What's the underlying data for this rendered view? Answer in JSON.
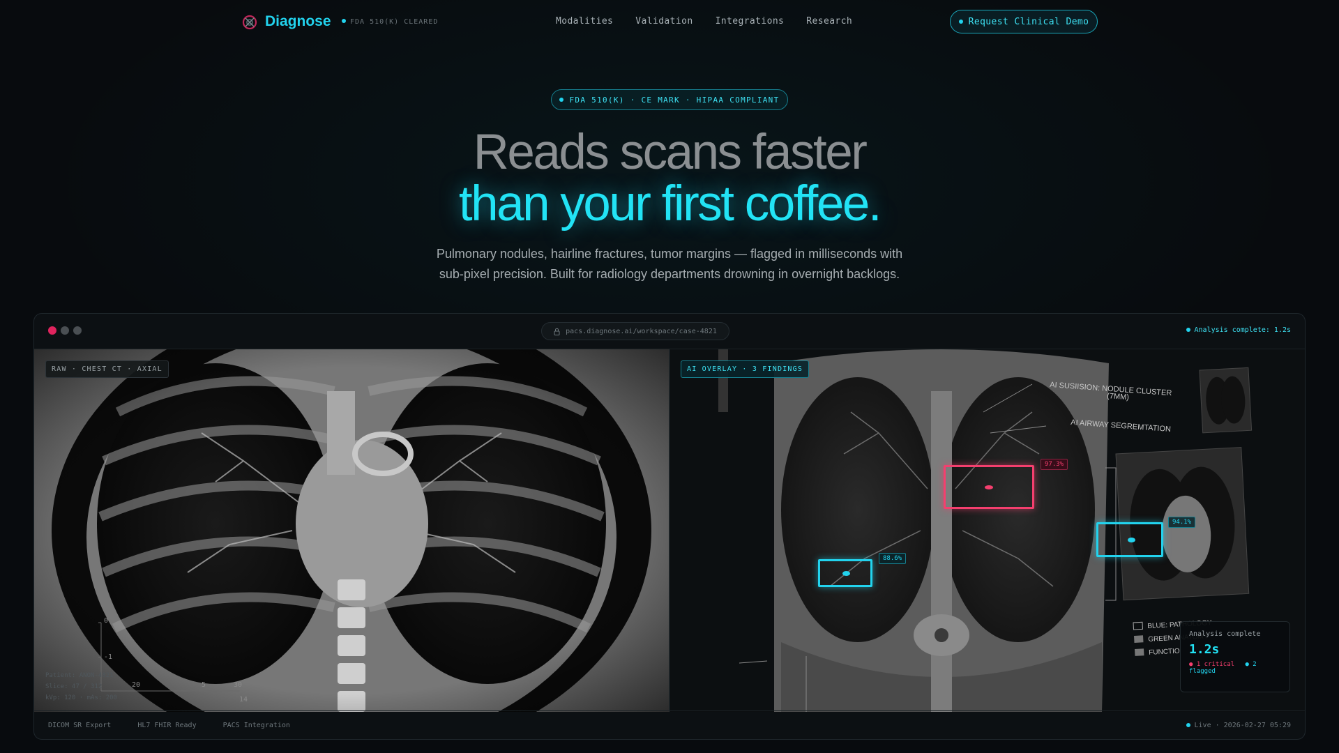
{
  "nav": {
    "brand": "Diagnose",
    "badge": "FDA 510(K) CLEARED",
    "links": [
      "Modalities",
      "Validation",
      "Integrations",
      "Research"
    ],
    "cta": "Request Clinical Demo"
  },
  "hero": {
    "pill": "FDA 510(K) · CE MARK · HIPAA COMPLIANT",
    "headline_1": "Reads scans faster",
    "headline_2": "than your first coffee.",
    "sub_1": "Pulmonary nodules, hairline fractures, tumor margins — flagged in milliseconds with",
    "sub_2": "sub-pixel precision. Built for radiology departments drowning in overnight backlogs."
  },
  "window": {
    "url": "pacs.diagnose.ai/workspace/case-4821",
    "status": "Analysis complete: 1.2s",
    "left_badge": "RAW · CHEST CT · AXIAL",
    "right_badge": "AI OVERLAY · 3 FINDINGS",
    "left_meta": [
      "Patient: ANON-4821",
      "Slice: 47 / 312",
      "kVp: 120 · mAs: 200"
    ],
    "scale_labels": [
      "0",
      "-1",
      "20",
      "5",
      "30",
      "14"
    ],
    "image_annotations": {
      "title_1": "AI SUSIISION: NODULE CLUSTER",
      "title_2": "(7MM)",
      "title_3": "AI AIRWAY SEGREMTATION",
      "legend_1": "BLUE: PATHOLOGY",
      "legend_2": "GREEN ANATOMY",
      "legend_3": "FUNCTIO"
    },
    "findings": [
      {
        "confidence": "97.3%",
        "severity": "critical"
      },
      {
        "confidence": "94.1%",
        "severity": "flagged"
      },
      {
        "confidence": "88.6%",
        "severity": "flagged"
      }
    ],
    "analysis_card": {
      "label": "Analysis complete",
      "time": "1.2s",
      "critical": "1 critical",
      "flagged": "2 flagged"
    },
    "footer_items": [
      "DICOM SR Export",
      "HL7 FHIR Ready",
      "PACS Integration"
    ],
    "live": "Live · 2026-02-27 05:29"
  },
  "colors": {
    "accent": "#22d3ee",
    "critical": "#f43f6e",
    "background": "#080b0e"
  }
}
